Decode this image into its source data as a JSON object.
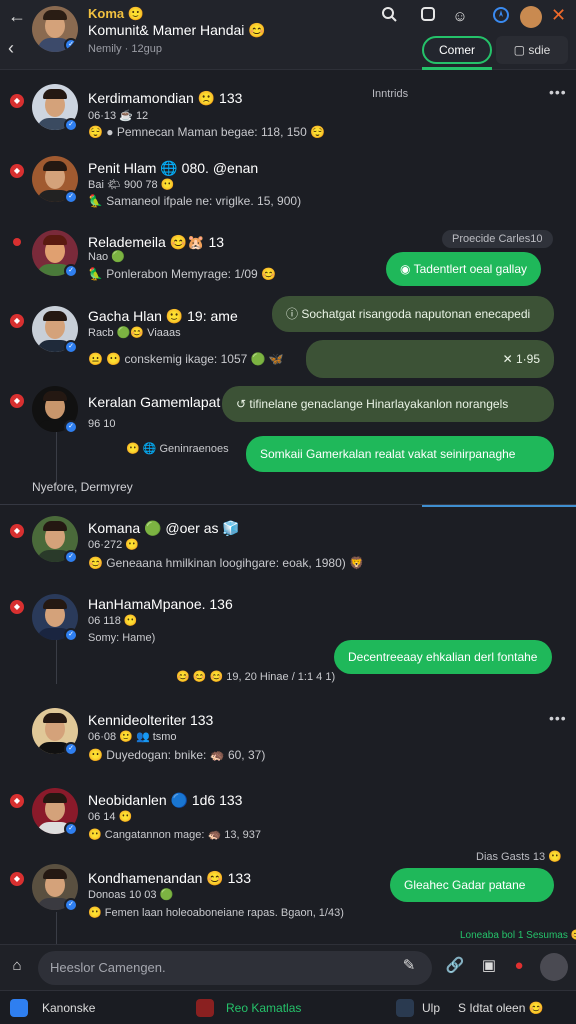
{
  "header": {
    "line1": "Koma 🙂",
    "line2": "Komunit& Mamer Handai 😊",
    "subtitle": "Nemily · 12gup",
    "tab_active": "Comer",
    "tab_other": "sdie",
    "accent": "#25c26a"
  },
  "feed": {
    "entries": [
      {
        "name": "Kerdimamondian 🙁 133",
        "meta": "06·13 ☕ 12",
        "line": "😌 ● Pemnecan Maman begae: 118, 150 😌",
        "side": "Inntrids"
      },
      {
        "name": "Penit Hlam 🌐 080. @enan",
        "meta": "Bai 🌤 900 78 😶",
        "line": "🦜 Samaneol ifpale ne: vriglke. 15, 900)",
        "side": ""
      },
      {
        "name": "Relademeila 😊🐹 13",
        "meta": "Nao 🟢",
        "line": "🦜 Ponlerabon Memyrage: 1/09 😊",
        "side": "Proecide Carles10"
      },
      {
        "name": "Gacha Hlan 🙂 19: ame",
        "meta": "Racb 🟢😊 Viaaas",
        "line": "😐 😶 conskemig ikage: 1057 🟢 🦋",
        "side": ""
      },
      {
        "name": "Keralan Gamemlapat",
        "meta": "96 10",
        "line": "😶 🌐 Geninraenoes",
        "side": ""
      },
      {
        "name": "Komana 🟢 @oer as 🧊",
        "meta": "06·272 😶",
        "line": "😊 Geneaana hmilkinan loogihgare: eoak, 1980) 🦁",
        "side": ""
      },
      {
        "name": "HanHamaMpanoe. 136",
        "meta": "06 118 😶",
        "line": "Somy: Hame)",
        "side": ""
      },
      {
        "name": "Kennideolteriter 133",
        "meta": "06·08 🙂 👥 tsmo",
        "line": "😶 Duyedogan: bnike: 🦔 60, 37)",
        "side": ""
      },
      {
        "name": "Neobidanlen 🔵 1d6 133",
        "meta": "06 14 😶",
        "line": "😶 Cangatannon mage: 🦔 13, 937",
        "side": ""
      },
      {
        "name": "Kondhamenandan 😊 133",
        "meta": "Donoas 10 03 🟢",
        "line": "😶 Femen laan holeoaboneiane rapas. Bgaon, 1/43)",
        "side": "Dias Gasts 13 😶"
      }
    ],
    "bubbles": [
      "Tadentlert oeal gallay",
      "Sochatgat risangoda naputonan enecapedi",
      "✕ 1·95",
      "tifinelane genaclange Hinarlayakanlon norangels",
      "Somkaii Gamerkalan realat vakat seinirpanaghe",
      "Decentreeaay ehkalian derl fontahe",
      "Gleahec Gadar patane"
    ],
    "reaction_line": "😊 😊 😊 19, 20 Hinae / 1:1 4 1)",
    "divider_label": "Nyefore,   Dermyrey",
    "bottom_note": "Loneaba bol 1 Sesumas 😊"
  },
  "composer": {
    "placeholder": "Heeslor Camengen."
  },
  "bottom": {
    "left": "Kanonske",
    "center": "Reo Kamatlas",
    "right_a": "Ulp",
    "right_b": "S Idtat oleen 😊"
  }
}
